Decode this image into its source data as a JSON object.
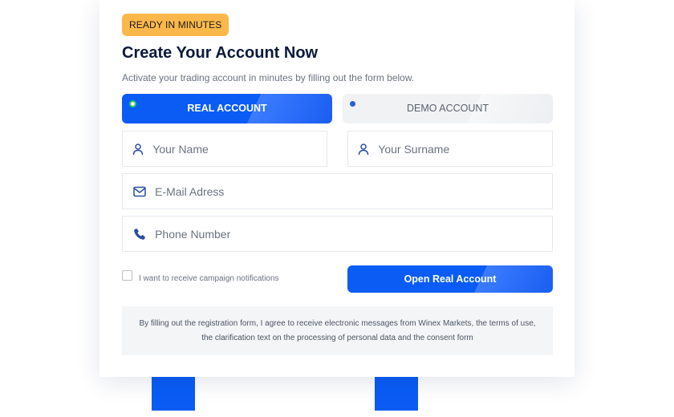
{
  "badge": "READY IN MINUTES",
  "title": "Create Your Account Now",
  "subtitle": "Activate your trading account in minutes by filling out the form below.",
  "tabs": {
    "real": "REAL ACCOUNT",
    "demo": "DEMO ACCOUNT"
  },
  "fields": {
    "name_placeholder": "Your Name",
    "surname_placeholder": "Your Surname",
    "email_placeholder": "E-Mail Adress",
    "phone_placeholder": "Phone Number"
  },
  "consent_label": "I want to receive campaign notifications",
  "submit_label": "Open Real Account",
  "terms_text": "By filling out the registration form, I agree to receive electronic messages from Winex Markets, the terms of use, the clarification text on the processing of personal data and the consent form",
  "icons": {
    "name": "user-icon",
    "surname": "user-icon",
    "email": "envelope-icon",
    "phone": "phone-icon"
  },
  "colors": {
    "primary": "#0a5cf5",
    "badge": "#fbb84a",
    "title": "#0b1a3a"
  }
}
